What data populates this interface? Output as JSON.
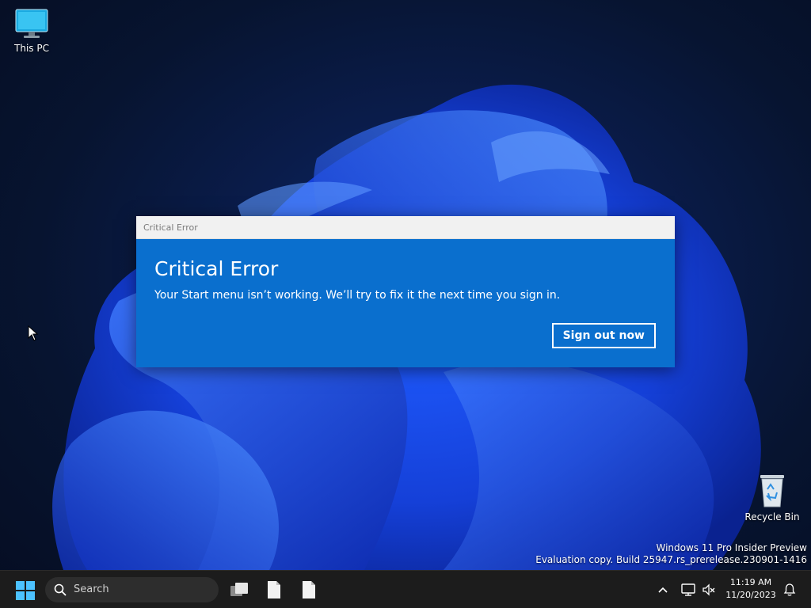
{
  "desktop": {
    "icons": [
      {
        "label": "This PC",
        "icon": "monitor-icon"
      },
      {
        "label": "Recycle Bin",
        "icon": "recycle-bin-icon"
      }
    ],
    "watermark": {
      "line1": "Windows 11 Pro Insider Preview",
      "line2": "Evaluation copy. Build 25947.rs_prerelease.230901-1416"
    }
  },
  "dialog": {
    "window_title": "Critical Error",
    "heading": "Critical Error",
    "message": "Your Start menu isn’t working. We’ll try to fix it the next time you sign in.",
    "button_label": "Sign out now",
    "accent_color": "#0a6fce"
  },
  "taskbar": {
    "search_placeholder": "Search",
    "pinned": [
      {
        "icon": "task-view-icon"
      },
      {
        "icon": "file-icon"
      },
      {
        "icon": "file-icon"
      }
    ],
    "tray": {
      "time": "11:19 AM",
      "date": "11/20/2023"
    }
  }
}
